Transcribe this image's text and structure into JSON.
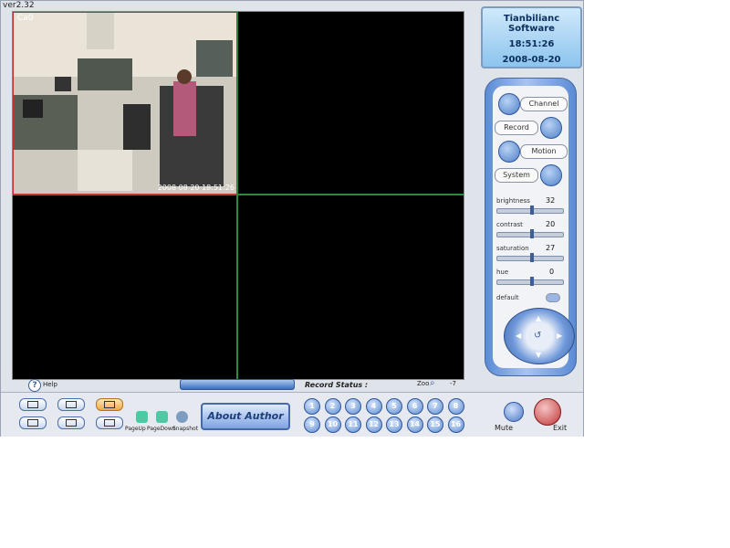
{
  "app": {
    "version": "ver2.32"
  },
  "camera": {
    "label": "Ca0",
    "timestamp": "2008 08 20 18:51:26"
  },
  "display": {
    "brand": "Tianbilianc Software",
    "time": "18:51:26",
    "date": "2008-08-20"
  },
  "controls": {
    "channel_label": "Channel",
    "record_label": "Record",
    "motion_label": "Motion",
    "system_label": "System",
    "sliders": [
      {
        "label": "brightness",
        "value": "32"
      },
      {
        "label": "contrast",
        "value": "20"
      },
      {
        "label": "saturation",
        "value": "27"
      },
      {
        "label": "hue",
        "value": "0"
      }
    ],
    "default_label": "default"
  },
  "status": {
    "help_label": "Help",
    "record_status_label": "Record Status :",
    "zoom_label": "Zoo",
    "zoom_value": "-7"
  },
  "toolbar": {
    "pageup_label": "PageUp",
    "pagedown_label": "PageDown",
    "snapshot_label": "Snapshot",
    "about_label": "About Author",
    "channels": [
      "1",
      "2",
      "3",
      "4",
      "5",
      "6",
      "7",
      "8",
      "9",
      "10",
      "11",
      "12",
      "13",
      "14",
      "15",
      "16"
    ],
    "mute_label": "Mute",
    "exit_label": "Exit"
  },
  "colors": {
    "accent": "#4f7fc8",
    "video_bg": "#000000",
    "active_cell_border": "#c03030",
    "cell_border": "#2b8a3e"
  },
  "icons": [
    "help-icon",
    "page-up-icon",
    "page-down-icon",
    "snapshot-icon",
    "speaker-icon",
    "power-icon",
    "refresh-icon"
  ]
}
